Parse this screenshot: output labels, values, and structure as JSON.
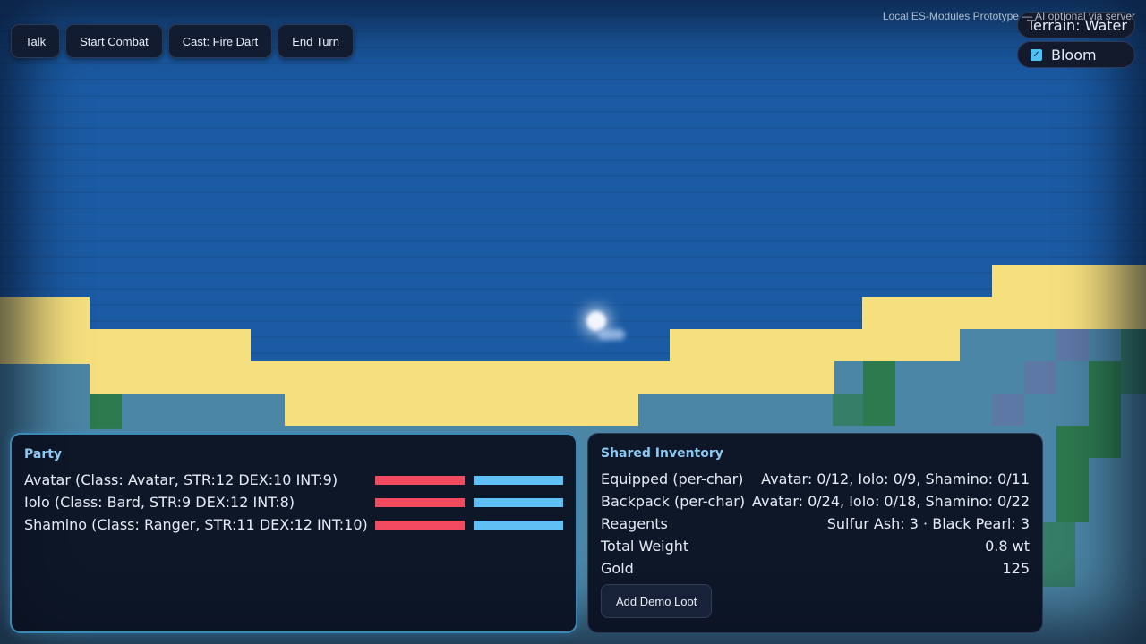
{
  "toolbar": {
    "buttons": [
      "Talk",
      "Start Combat",
      "Cast: Fire Dart",
      "End Turn"
    ]
  },
  "header": {
    "subtitle": "Local ES-Modules Prototype — AI optional via server",
    "terrain": "Terrain: Water",
    "bloom_label": "Bloom",
    "bloom_checked": true
  },
  "party": {
    "title": "Party",
    "members": [
      {
        "label": "Avatar (Class: Avatar, STR:12 DEX:10 INT:9)",
        "hp": 1.0,
        "mp": 1.0
      },
      {
        "label": "Iolo (Class: Bard, STR:9 DEX:12 INT:8)",
        "hp": 1.0,
        "mp": 1.0
      },
      {
        "label": "Shamino (Class: Ranger, STR:11 DEX:12 INT:10)",
        "hp": 1.0,
        "mp": 1.0
      }
    ]
  },
  "inventory": {
    "title": "Shared Inventory",
    "rows": [
      {
        "label": "Equipped (per-char)",
        "value": "Avatar: 0/12, Iolo: 0/9, Shamino: 0/11"
      },
      {
        "label": "Backpack (per-char)",
        "value": "Avatar: 0/24, Iolo: 0/18, Shamino: 0/22"
      },
      {
        "label": "Reagents",
        "value": "Sulfur Ash: 3 · Black Pearl: 3"
      },
      {
        "label": "Total Weight",
        "value": "0.8 wt"
      },
      {
        "label": "Gold",
        "value": "125"
      }
    ],
    "loot_button": "Add Demo Loot"
  },
  "colors": {
    "water": "#1b5ba4",
    "sand": "#f6e07e",
    "hp_bar": "#f24a5e",
    "mp_bar": "#5ec0f5",
    "accent": "#8cc8f0"
  }
}
